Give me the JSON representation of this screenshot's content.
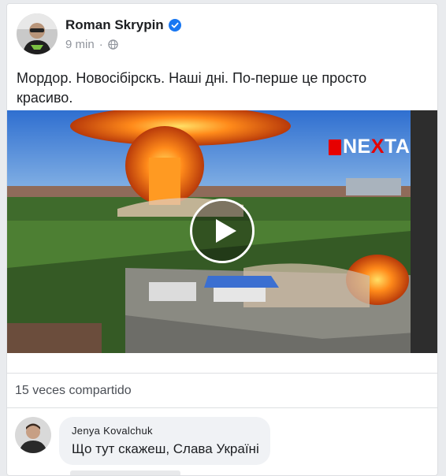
{
  "post": {
    "author": "Roman Skrypin",
    "time": "9 min",
    "separator": "·",
    "text": "Мордор. Новосібірскъ. Наші дні. По-перше це просто красиво."
  },
  "video": {
    "brand_prefix": "",
    "brand_mark_x": "X",
    "brand_start": "NE",
    "brand_end": "TA"
  },
  "stats": {
    "shares": "15 veces compartido"
  },
  "comment": {
    "author": "Jenya Kovalchuk",
    "text": "Що тут скажеш, Слава Україні"
  },
  "colors": {
    "brand_red": "#e60000",
    "verified_blue": "#1877f2"
  },
  "icons": {
    "verified": "verified-badge-icon",
    "audience": "globe-icon",
    "play": "play-icon"
  }
}
